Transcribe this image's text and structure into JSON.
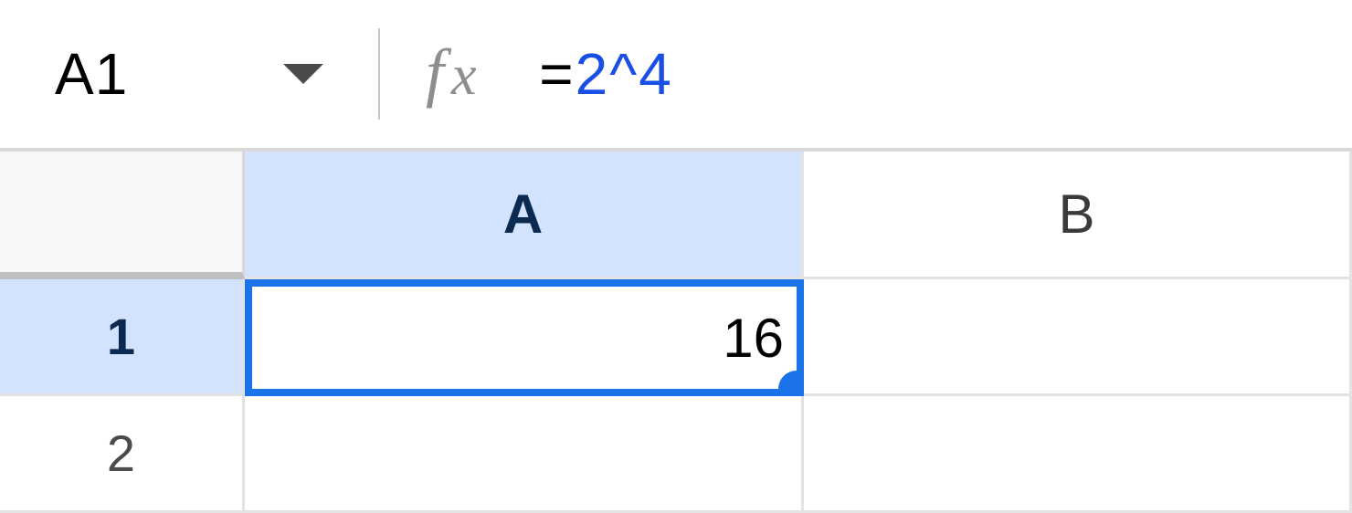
{
  "formula_bar": {
    "name_box": "A1",
    "formula_equals": "=",
    "formula_operand1": "2",
    "formula_caret": "^",
    "formula_operand2": "4"
  },
  "columns": {
    "A": "A",
    "B": "B"
  },
  "rows": {
    "r1": "1",
    "r2": "2"
  },
  "cells": {
    "A1": "16",
    "B1": "",
    "A2": "",
    "B2": ""
  }
}
